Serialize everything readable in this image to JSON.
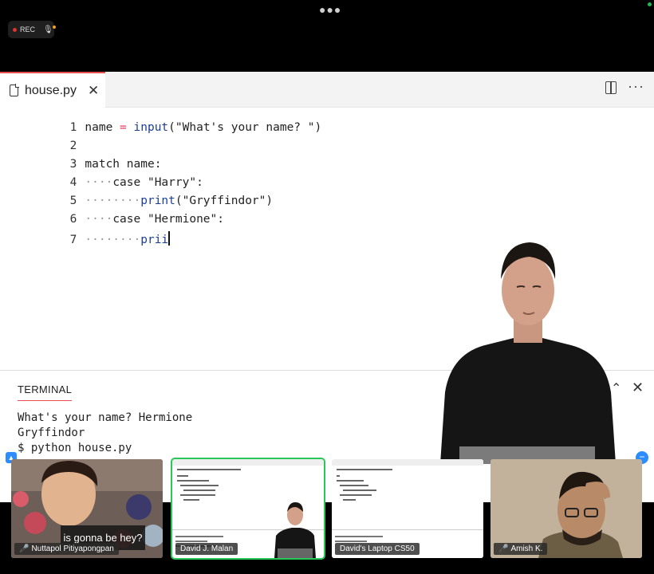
{
  "recording": {
    "label": "REC"
  },
  "editor": {
    "tab": {
      "filename": "house.py",
      "close": "✕"
    },
    "lines": [
      {
        "n": "1"
      },
      {
        "n": "2"
      },
      {
        "n": "3"
      },
      {
        "n": "4"
      },
      {
        "n": "5"
      },
      {
        "n": "6"
      },
      {
        "n": "7"
      }
    ],
    "code": {
      "l1_var": "name",
      "l1_eq": "=",
      "l1_fn": "input",
      "l1_arg": "(\"What's your name? \")",
      "l3": "match name:",
      "l4_ws": "····",
      "l4_code": "case \"Harry\":",
      "l5_ws": "········",
      "l5_fn": "print",
      "l5_arg": "(\"Gryffindor\")",
      "l6_ws": "····",
      "l6_code": "case \"Hermione\":",
      "l7_ws": "········",
      "l7_fn": "prii"
    }
  },
  "terminal": {
    "tab": "TERMINAL",
    "lines": [
      "What's your name? Hermione",
      "Gryffindor",
      "$ python house.py"
    ]
  },
  "participants": [
    {
      "name": "Nuttapol Pitiyapongpan",
      "muted": true,
      "caption": "is gonna be hey?"
    },
    {
      "name": "David J. Malan",
      "muted": false,
      "active": true
    },
    {
      "name": "David's Laptop CS50",
      "muted": false
    },
    {
      "name": "Amish K.",
      "muted": true
    }
  ],
  "colors": {
    "accent": "#e94f4f",
    "active_speaker": "#29c75a",
    "zoom_blue": "#2d8cff"
  }
}
